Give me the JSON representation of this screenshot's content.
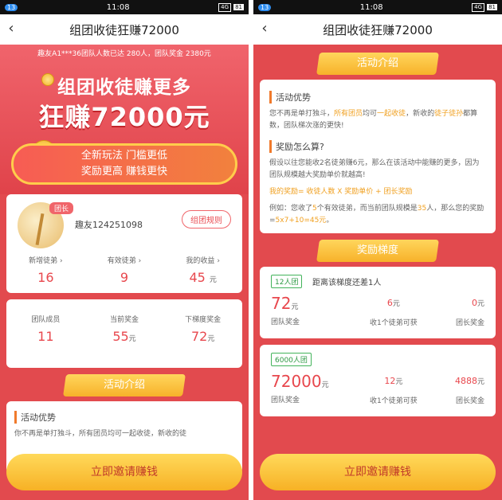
{
  "status": {
    "time": "11:08",
    "notif_badge": "13",
    "notif_badge_right": "13",
    "signal": "4G",
    "battery": "81"
  },
  "nav": {
    "title": "组团收徒狂赚72000"
  },
  "left": {
    "notice": "趣友A1***36团队人数已达 280人，团队奖金 2380元",
    "hero_line1": "组团收徒赚更多",
    "hero_line2": "狂赚72000元",
    "hero_sub1": "全新玩法 门槛更低",
    "hero_sub2": "奖励更高 赚钱更快",
    "profile": {
      "tag": "团长",
      "username": "趣友124251098",
      "rule_button": "组团规则",
      "stats": [
        {
          "label": "新增徒弟",
          "value": "16",
          "unit": "",
          "arrow": "›"
        },
        {
          "label": "有效徒弟",
          "value": "9",
          "unit": "",
          "arrow": "›"
        },
        {
          "label": "我的收益",
          "value": "45",
          "unit": "元",
          "arrow": "›"
        }
      ]
    },
    "team": {
      "stats": [
        {
          "label": "团队成员",
          "value": "11",
          "unit": ""
        },
        {
          "label": "当前奖金",
          "value": "55",
          "unit": "元"
        },
        {
          "label": "下梯度奖金",
          "value": "72",
          "unit": "元"
        }
      ]
    },
    "ribbon": "活动介绍",
    "sec1_title": "活动优势",
    "partial_line": "你不再是单打独斗，所有团员均可一起收徒，新收的徒",
    "cta": "立即邀请赚钱"
  },
  "right": {
    "ribbon1": "活动介绍",
    "sec1_title": "活动优势",
    "sec1_p1a": "您不再是单打独斗，",
    "sec1_p1b": "所有团员",
    "sec1_p1c": "均可",
    "sec1_p1d": "一起收徒",
    "sec1_p1e": "，新收的",
    "sec1_p1f": "徒子徒孙",
    "sec1_p1g": "都算数，团队梯次涨的更快!",
    "sec2_title": "奖励怎么算?",
    "sec2_p1": "假设以往您能收2名徒弟赚6元，那么在该活动中能赚的更多，因为团队规模越大奖励单价就越高!",
    "formula": "我的奖励= 收徒人数 X 奖励单价 + 团长奖励",
    "example_a": "例如：您收了",
    "example_b": "5",
    "example_c": "个有效徒弟，而当前团队规模是",
    "example_d": "35",
    "example_e": "人，那么您的奖励=",
    "example_f": "5x7+10=45元",
    "example_g": "。",
    "ribbon2": "奖励梯度",
    "tiers": [
      {
        "tag": "12人团",
        "note": "距离该梯度还差1人",
        "team_bonus": "72",
        "team_bonus_unit": "元",
        "team_bonus_label": "团队奖金",
        "per_bonus": "6",
        "per_bonus_unit": "元",
        "per_bonus_label": "收1个徒弟可获",
        "leader_bonus": "0",
        "leader_bonus_unit": "元",
        "leader_bonus_label": "团长奖金"
      },
      {
        "tag": "6000人团",
        "note": "",
        "team_bonus": "72000",
        "team_bonus_unit": "元",
        "team_bonus_label": "团队奖金",
        "per_bonus": "12",
        "per_bonus_unit": "元",
        "per_bonus_label": "收1个徒弟可获",
        "leader_bonus": "4888",
        "leader_bonus_unit": "元",
        "leader_bonus_label": "团长奖金"
      }
    ],
    "cta": "立即邀请赚钱"
  }
}
